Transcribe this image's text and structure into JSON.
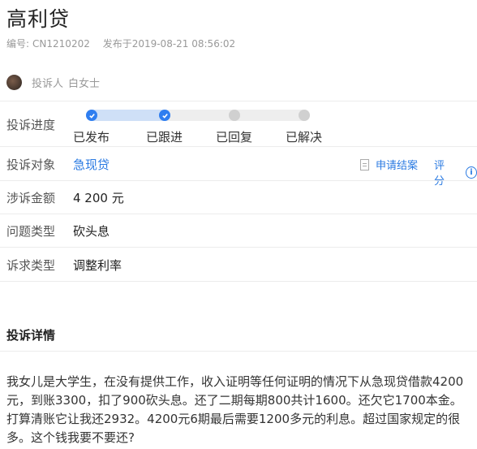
{
  "header": {
    "title": "高利贷",
    "id_label": "编号:",
    "id_value": "CN1210202",
    "published": "发布于2019-08-21 08:56:02"
  },
  "complainant": {
    "label": "投诉人",
    "name": "白女士"
  },
  "progress": {
    "label": "投诉进度",
    "steps": [
      {
        "label": "已发布",
        "done": true
      },
      {
        "label": "已跟进",
        "done": true
      },
      {
        "label": "已回复",
        "done": false
      },
      {
        "label": "已解决",
        "done": false
      }
    ],
    "colors": {
      "done": "#2f7ef0",
      "done_track": "#cfe0f7",
      "todo": "#d0d0d0"
    }
  },
  "fields": {
    "target_label": "投诉对象",
    "target_value": "急现贷",
    "amount_label": "涉诉金额",
    "amount_value": "4 200 元",
    "issue_label": "问题类型",
    "issue_value": "砍头息",
    "demand_label": "诉求类型",
    "demand_value": "调整利率"
  },
  "actions": {
    "apply_close": "申请结案",
    "rate": "评分"
  },
  "details": {
    "title": "投诉详情",
    "text": "我女儿是大学生，在没有提供工作，收入证明等任何证明的情况下从急现贷借款4200元，到账3300，扣了900砍头息。还了二期每期800共计1600。还欠它1700本金。打算清账它让我还2932。4200元6期最后需要1200多元的利息。超过国家规定的很多。这个钱我要不要还?"
  },
  "icons": [
    "avatar",
    "check-icon",
    "document-icon",
    "info-icon"
  ]
}
